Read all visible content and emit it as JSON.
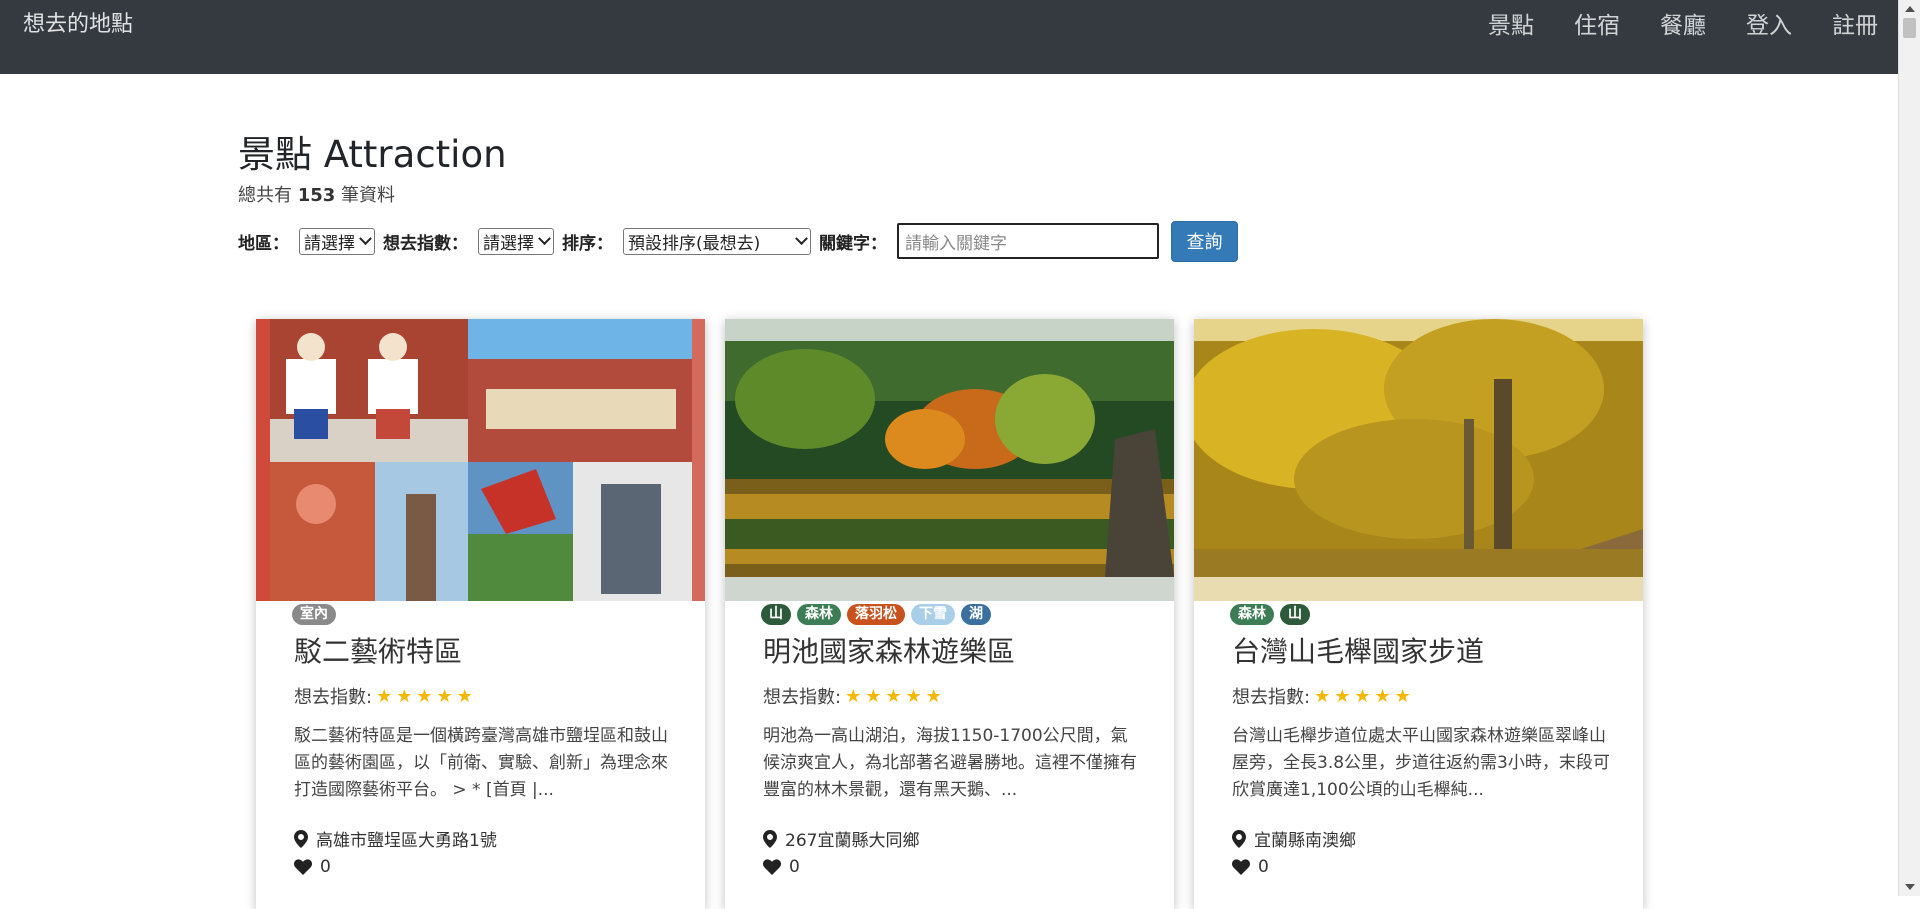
{
  "navbar": {
    "brand": "想去的地點",
    "links": [
      "景點",
      "住宿",
      "餐廳",
      "登入",
      "註冊"
    ]
  },
  "header": {
    "title": "景點 Attraction",
    "total_prefix": "總共有",
    "total_count": "153",
    "total_suffix": "筆資料"
  },
  "filters": {
    "region_label": "地區：",
    "region_value": "請選擇",
    "index_label": "想去指數：",
    "index_value": "請選擇",
    "sort_label": "排序：",
    "sort_value": "預設排序(最想去)",
    "keyword_label": "關鍵字：",
    "keyword_placeholder": "請輸入關鍵字",
    "search_button": "查詢"
  },
  "cards": [
    {
      "tags": [
        {
          "label": "室內",
          "color": "#8a8a8a"
        }
      ],
      "title": "駁二藝術特區",
      "rating_label": "想去指數:",
      "stars": "★★★★★",
      "description": "駁二藝術特區是一個橫跨臺灣高雄市鹽埕區和鼓山區的藝術園區，以「前衛、實驗、創新」為理念來打造國際藝術平台。 > * [首頁 |...",
      "address": "高雄市鹽埕區大勇路1號",
      "likes": "0"
    },
    {
      "tags": [
        {
          "label": "山",
          "color": "#2d5a3a"
        },
        {
          "label": "森林",
          "color": "#3d7d55"
        },
        {
          "label": "落羽松",
          "color": "#c8511d"
        },
        {
          "label": "下雪",
          "color": "#a9cfe8"
        },
        {
          "label": "湖",
          "color": "#3a6fa0"
        }
      ],
      "title": "明池國家森林遊樂區",
      "rating_label": "想去指數:",
      "stars": "★★★★★",
      "description": "明池為一高山湖泊，海拔1150-1700公尺間，氣候涼爽宜人，為北部著名避暑勝地。這裡不僅擁有豐富的林木景觀，還有黑天鵝、...",
      "address": "267宜蘭縣大同鄉",
      "likes": "0"
    },
    {
      "tags": [
        {
          "label": "森林",
          "color": "#3d7d55"
        },
        {
          "label": "山",
          "color": "#2d5a3a"
        }
      ],
      "title": "台灣山毛櫸國家步道",
      "rating_label": "想去指數:",
      "stars": "★★★★★",
      "description": "台灣山毛櫸步道位處太平山國家森林遊樂區翠峰山屋旁，全長3.8公里，步道往返約需3小時，末段可欣賞廣達1,100公頃的山毛櫸純...",
      "address": "宜蘭縣南澳鄉",
      "likes": "0"
    }
  ]
}
